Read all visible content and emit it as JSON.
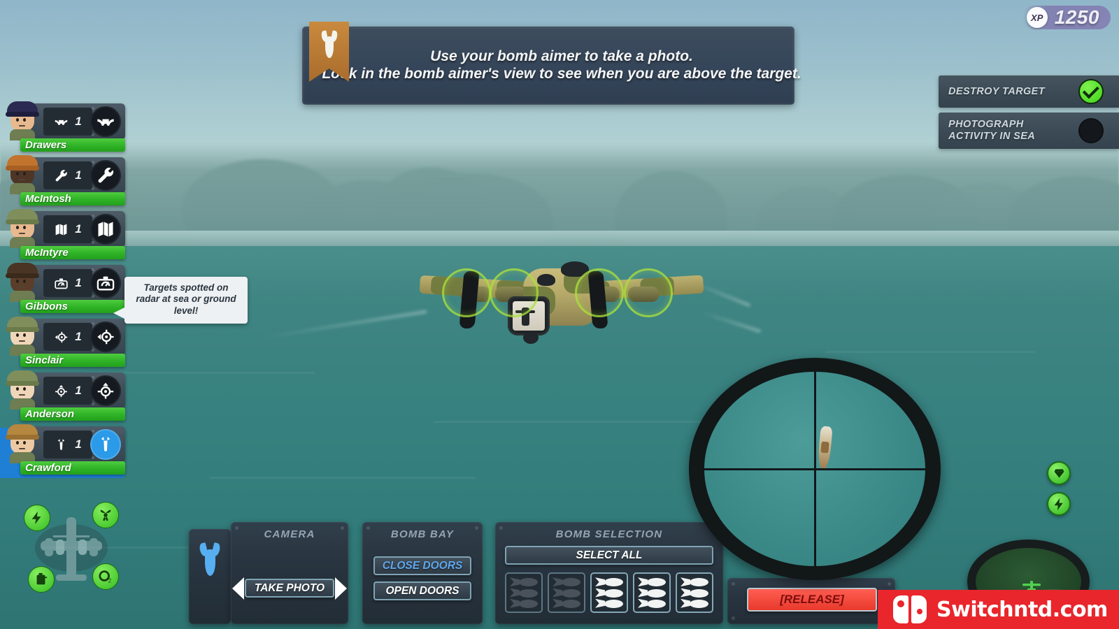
{
  "hud": {
    "xp": {
      "badge_label": "XP",
      "value": "1250"
    },
    "banner": {
      "line1": "Use your bomb aimer to take a photo.",
      "line2": "Look in the bomb aimer's view to see when you are above the target.",
      "ribbon_icon": "bomb-icon"
    },
    "objectives": [
      {
        "label": "DESTROY TARGET",
        "state": "complete",
        "icon": "check-icon"
      },
      {
        "label": "PHOTOGRAPH\nACTIVITY IN SEA",
        "label_line1": "PHOTOGRAPH",
        "label_line2": "ACTIVITY IN SEA",
        "state": "pending",
        "icon": "empty-circle-icon"
      }
    ]
  },
  "crew": {
    "selected": "Crawford",
    "members": [
      {
        "name": "Drawers",
        "role": "pilot",
        "role_icon": "yoke-icon",
        "count": "1",
        "selected": false,
        "health": 100,
        "hat_color": "#2a2a52",
        "hat_brim_color": "#1d1d3e",
        "skin_color": "#e8b98f"
      },
      {
        "name": "McIntosh",
        "role": "engineer",
        "role_icon": "wrench-icon",
        "count": "1",
        "selected": false,
        "health": 100,
        "hat_color": "#c2742f",
        "hat_brim_color": "#a75f24",
        "skin_color": "#4e3525"
      },
      {
        "name": "McIntyre",
        "role": "navigator",
        "role_icon": "map-icon",
        "count": "1",
        "selected": false,
        "health": 100,
        "hat_color": "#7f8e5a",
        "hat_brim_color": "#6b7a49",
        "skin_color": "#e8b98f"
      },
      {
        "name": "Gibbons",
        "role": "radar-operator",
        "role_icon": "radar-icon",
        "count": "1",
        "selected": false,
        "health": 100,
        "hat_color": "#4a3524",
        "hat_brim_color": "#3a2a1c",
        "skin_color": "#5b3e2a"
      },
      {
        "name": "Sinclair",
        "role": "gunner",
        "role_icon": "turret-left-icon",
        "count": "1",
        "selected": false,
        "health": 100,
        "hat_color": "#7f8e5a",
        "hat_brim_color": "#6b7a49",
        "skin_color": "#f0d6b8"
      },
      {
        "name": "Anderson",
        "role": "gunner",
        "role_icon": "turret-up-icon",
        "count": "1",
        "selected": false,
        "health": 100,
        "hat_color": "#7f8e5a",
        "hat_brim_color": "#6b7a49",
        "skin_color": "#f0d6b8"
      },
      {
        "name": "Crawford",
        "role": "bomb-aimer",
        "role_icon": "bomb-icon",
        "count": "1",
        "selected": true,
        "health": 100,
        "hat_color": "#b5873f",
        "hat_brim_color": "#9a7132",
        "skin_color": "#edc9a3"
      }
    ],
    "speech_bubble": {
      "speaker": "Gibbons",
      "text": "Targets spotted on radar at sea or ground level!"
    }
  },
  "aircraft_status": {
    "indicators": [
      {
        "name": "electrical",
        "icon": "lightning-icon",
        "state": "ok"
      },
      {
        "name": "engines",
        "icon": "propeller-icon",
        "state": "ok"
      },
      {
        "name": "fuel",
        "icon": "fuel-can-icon",
        "state": "ok"
      },
      {
        "name": "oxygen",
        "icon": "oxygen-icon",
        "label": "O2",
        "state": "ok"
      }
    ]
  },
  "console": {
    "bomb_tab_icon": "bomb-icon",
    "camera": {
      "title": "CAMERA",
      "take_photo_label": "TAKE PHOTO"
    },
    "bomb_bay": {
      "title": "BOMB BAY",
      "close_doors_label": "CLOSE DOORS",
      "open_doors_label": "OPEN DOORS",
      "active": "CLOSE DOORS"
    },
    "bomb_selection": {
      "title": "BOMB SELECTION",
      "select_all_label": "SELECT ALL",
      "slots": [
        {
          "index": 1,
          "state": "empty",
          "bombs": 3
        },
        {
          "index": 2,
          "state": "empty",
          "bombs": 3
        },
        {
          "index": 3,
          "state": "loaded",
          "bombs": 3
        },
        {
          "index": 4,
          "state": "loaded",
          "bombs": 3
        },
        {
          "index": 5,
          "state": "loaded",
          "bombs": 3
        }
      ]
    },
    "release": {
      "label": "[RELEASE]"
    }
  },
  "bomb_aimer": {
    "crosshair": true,
    "target": "ship"
  },
  "side_controls": [
    {
      "name": "view-toggle",
      "icon": "gem-icon"
    },
    {
      "name": "power-boost",
      "icon": "lightning-icon"
    }
  ],
  "radar": {
    "blip": "own-aircraft",
    "sweep": true
  },
  "watermark": {
    "text": "Switchntd.com",
    "logo": "switch-joycon-logo"
  },
  "colors": {
    "accent_green": "#2fb326",
    "accent_blue": "#2b9ae8",
    "danger_red": "#e8392c",
    "panel_dark": "#28343f",
    "banner_blue": "#36465a",
    "sea": "#3f8582",
    "xp_purple": "#7e74ac",
    "watermark_red": "#e8262c"
  }
}
